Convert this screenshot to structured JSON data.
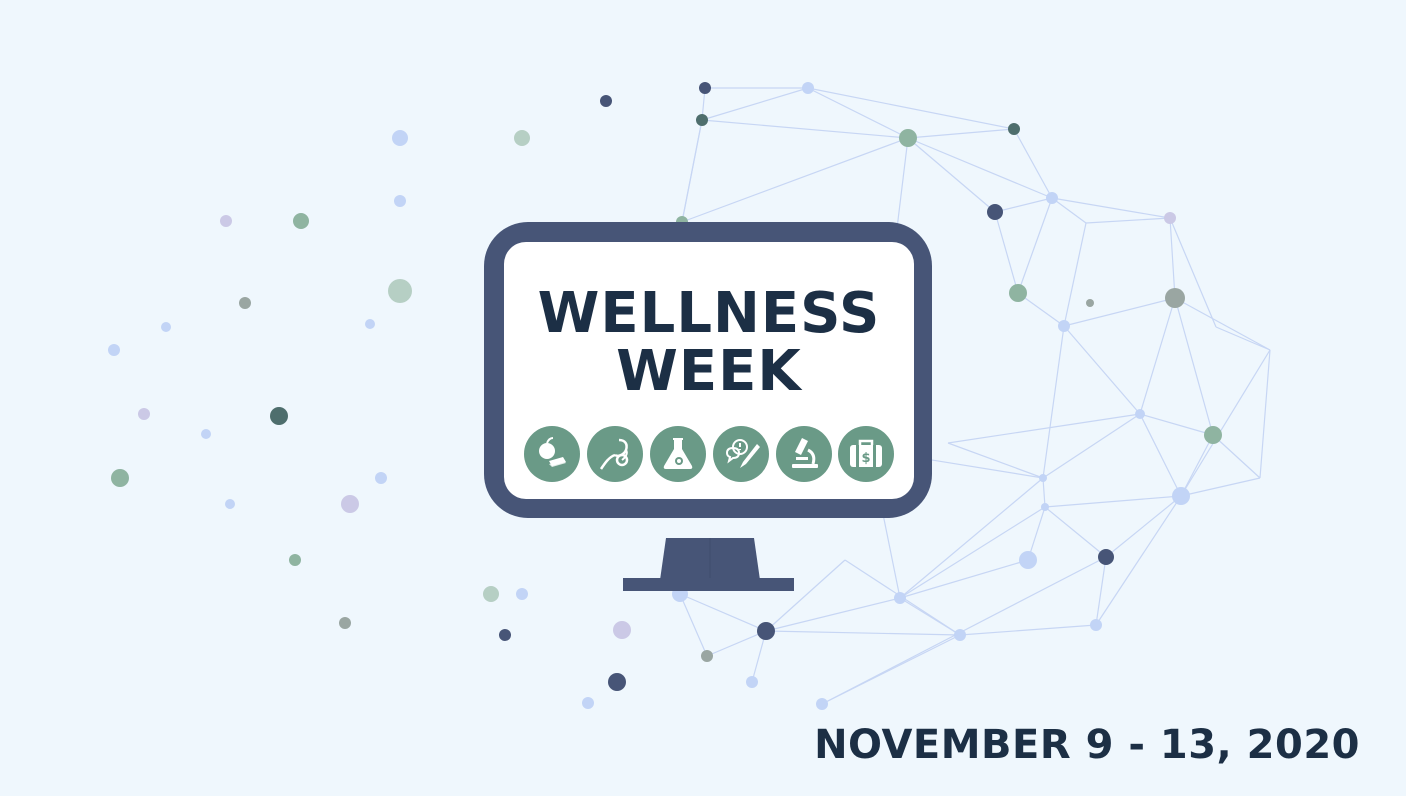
{
  "banner": {
    "title_line1": "WELLNESS",
    "title_line2": "WEEK",
    "date": "NOVEMBER 9 - 13, 2020"
  },
  "icons": [
    "apple-book-icon",
    "stethoscope-icon",
    "flask-icon",
    "chat-brush-icon",
    "microscope-icon",
    "briefcase-dollar-icon"
  ],
  "colors": {
    "background": "#eff7fd",
    "monitor": "#475577",
    "text": "#1c2f45",
    "icon_circle": "#6a9a87",
    "network_line": "#c7d6f4"
  }
}
